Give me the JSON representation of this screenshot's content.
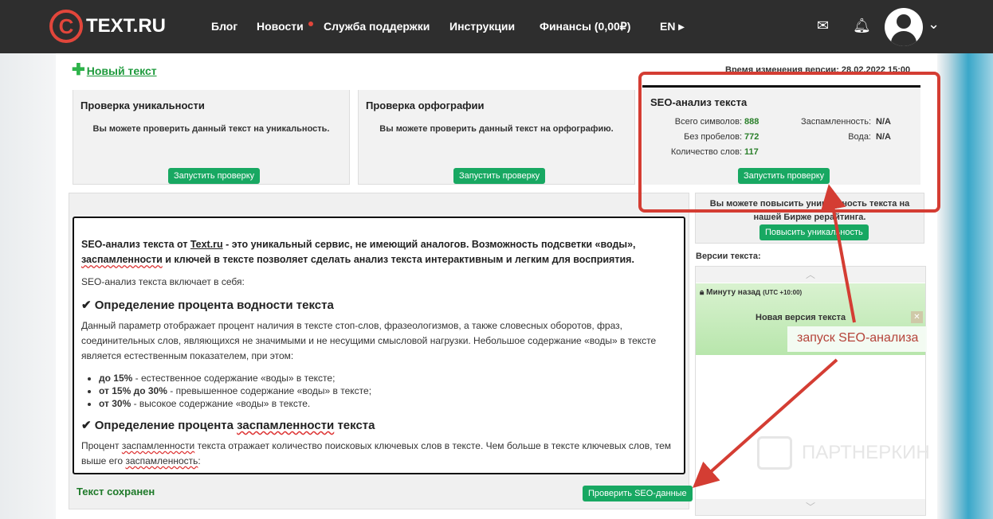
{
  "header": {
    "logo": "TEXT.RU",
    "nav": [
      "Блог",
      "Новости",
      "Служба поддержки",
      "Инструкции",
      "Финансы (0,00₽)",
      "EN"
    ]
  },
  "new_text": "Новый текст",
  "version_time": "Время изменения версии: 28.02.2022 15:00",
  "cards": [
    {
      "title": "Проверка уникальности",
      "desc": "Вы можете проверить данный текст на уникальность.",
      "button": "Запустить проверку"
    },
    {
      "title": "Проверка орфографии",
      "desc": "Вы можете проверить данный текст на орфографию.",
      "button": "Запустить проверку"
    }
  ],
  "seo": {
    "title": "SEO-анализ текста",
    "total_label": "Всего символов:",
    "total": "888",
    "nospace_label": "Без пробелов:",
    "nospace": "772",
    "words_label": "Количество слов:",
    "words": "117",
    "spam_label": "Заспамленность:",
    "spam": "N/A",
    "water_label": "Вода:",
    "water": "N/A",
    "button": "Запустить проверку"
  },
  "text": {
    "lead1": "SEO-анализ текста от ",
    "lead_link": "Text.ru",
    "lead2": " - это уникальный сервис, не имеющий аналогов. Возможность подсветки «воды», ",
    "lead_sp": "заспамленности",
    "lead3": " и ключей в тексте позволяет сделать анализ текста интерактивным и легким для восприятия.",
    "intro": "SEO-анализ текста включает в себя:",
    "h1": "✔ Определение процента водности текста",
    "p1": "Данный параметр отображает процент наличия в тексте стоп-слов, фразеологизмов, а также словесных оборотов, фраз, соединительных слов, являющихся не значимыми и не несущими смысловой нагрузки. Небольшое содержание «воды» в тексте является естественным показателем, при этом:",
    "list": [
      {
        "b": "до 15%",
        "t": " - естественное содержание «воды» в тексте;"
      },
      {
        "b": "от 15% до 30%",
        "t": " - превышенное содержание «воды» в тексте;"
      },
      {
        "b": "от 30%",
        "t": " - высокое содержание «воды» в тексте."
      }
    ],
    "h2a": "✔ Определение процента ",
    "h2sp": "заспамленности",
    "h2b": " текста",
    "p2a": "Процент ",
    "p2sp": "заспамленности",
    "p2b": " текста отражает количество поисковых ключевых слов в тексте. Чем больше в тексте ключевых слов, тем выше его ",
    "p2sp2": "заспамленность",
    "p2c": ":"
  },
  "saved": "Текст сохранен",
  "check_seo": "Проверить SEO-данные",
  "promo": {
    "text": "Вы можете повысить уникальность текста на нашей Бирже рерайтинга.",
    "button": "Повысить уникальность"
  },
  "versions": {
    "label": "Версии текста:",
    "time": "Минуту назад",
    "tz": "(UTC +10:00)",
    "name": "Новая версия текста"
  },
  "annotation": "запуск SEO-анализа",
  "watermark": "ПАРТНЕРКИН",
  "colors": {
    "accent": "#18a862",
    "annotation": "#d43d33",
    "header": "#2e2e2e"
  }
}
